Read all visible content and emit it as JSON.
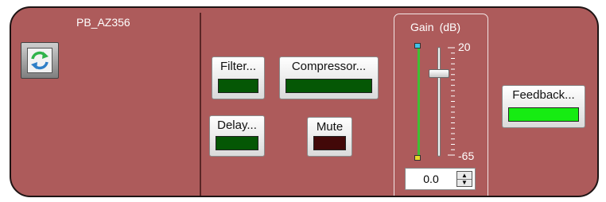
{
  "panel": {
    "title": "PB_AZ356",
    "refresh_icon": "refresh-icon"
  },
  "buttons": {
    "filter": {
      "label": "Filter...",
      "led_color": "#055705"
    },
    "compressor": {
      "label": "Compressor...",
      "led_color": "#055705"
    },
    "delay": {
      "label": "Delay...",
      "led_color": "#055705"
    },
    "mute": {
      "label": "Mute",
      "led_color": "#420808"
    },
    "feedback": {
      "label": "Feedback...",
      "led_color": "#16ec12"
    }
  },
  "gain": {
    "title": "Gain",
    "unit": "(dB)",
    "scale_max": "20",
    "scale_min": "-65",
    "value": "0.0",
    "slider_level": 0.765,
    "spin_up_icon": "arrow-up-icon",
    "spin_down_icon": "arrow-down-icon"
  },
  "colors": {
    "panel_bg": "#ad5b5b",
    "meter_green": "#3fbf33",
    "meter_top_cap": "#41c3e9",
    "meter_bottom_cap": "#e7d629"
  }
}
